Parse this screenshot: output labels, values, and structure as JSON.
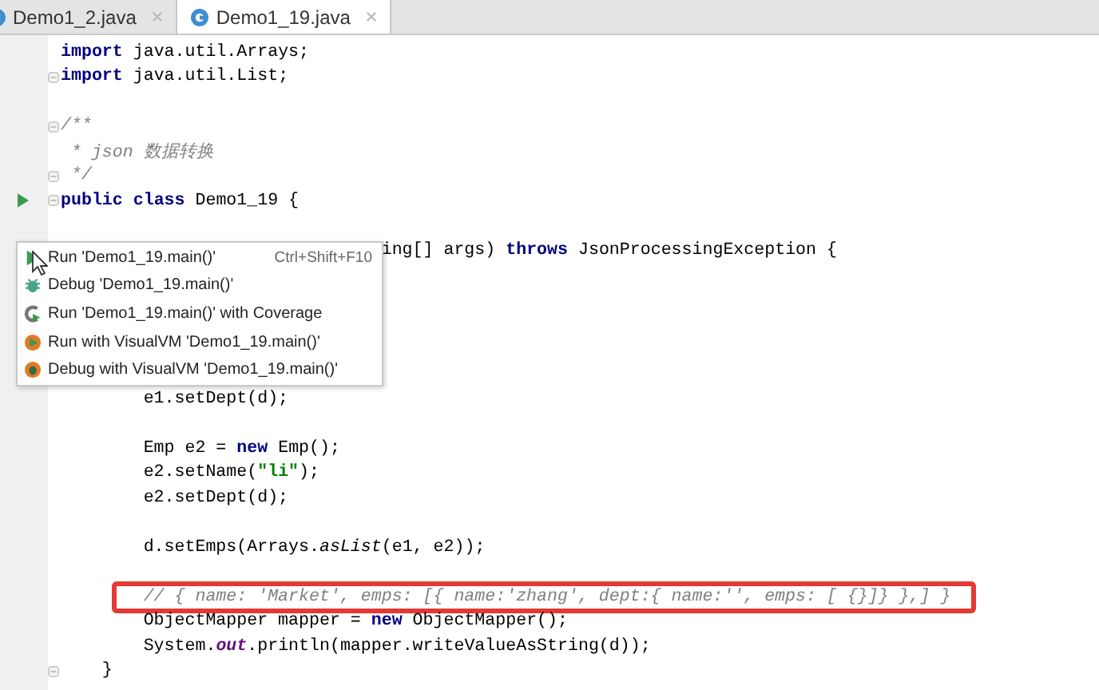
{
  "tabs": [
    {
      "label": "Demo1_2.java",
      "selected": false
    },
    {
      "label": "Demo1_19.java",
      "selected": true
    }
  ],
  "code_blocks": [
    {
      "menu_after": false,
      "lines": [
        {
          "fold": false,
          "run": false,
          "tokens": [
            {
              "kind": "keyword",
              "text": "import"
            },
            {
              "kind": "plain",
              "text": " java.util.Arrays;"
            }
          ]
        },
        {
          "fold": true,
          "run": false,
          "tokens": [
            {
              "kind": "keyword",
              "text": "import"
            },
            {
              "kind": "plain",
              "text": " java.util.List;"
            }
          ]
        }
      ]
    },
    {
      "menu_after": false,
      "lines": [
        {
          "fold": true,
          "run": false,
          "tokens": [
            {
              "kind": "comment",
              "text": "/**"
            }
          ]
        },
        {
          "fold": false,
          "run": false,
          "tokens": [
            {
              "kind": "comment",
              "text": " * json 数据转换"
            }
          ]
        },
        {
          "fold": true,
          "run": false,
          "tokens": [
            {
              "kind": "comment",
              "text": " */"
            }
          ]
        },
        {
          "fold": true,
          "run": true,
          "tokens": [
            {
              "kind": "keyword",
              "text": "public class"
            },
            {
              "kind": "plain",
              "text": " Demo1_19 {"
            }
          ]
        }
      ]
    },
    {
      "menu_after": true,
      "lines": [
        {
          "tokens": [
            {
              "kind": "plain",
              "text": "                               ing[] args) "
            },
            {
              "kind": "keyword",
              "text": "throws"
            },
            {
              "kind": "plain",
              "text": " JsonProcessingException {"
            }
          ]
        }
      ]
    },
    {
      "menu_after": false,
      "lines": [
        {
          "tokens": [
            {
              "kind": "plain",
              "text": "        e1.setDept(d);"
            }
          ]
        }
      ]
    },
    {
      "menu_after": false,
      "lines": [
        {
          "fold": false,
          "run": false,
          "tokens": [
            {
              "kind": "plain",
              "text": "        Emp e2 = "
            },
            {
              "kind": "keyword",
              "text": "new"
            },
            {
              "kind": "plain",
              "text": " Emp();"
            }
          ]
        },
        {
          "fold": false,
          "run": false,
          "tokens": [
            {
              "kind": "plain",
              "text": "        e2.setName("
            },
            {
              "kind": "string",
              "text": "\"li\""
            },
            {
              "kind": "plain",
              "text": ");"
            }
          ]
        },
        {
          "fold": false,
          "run": false,
          "tokens": [
            {
              "kind": "plain",
              "text": "        e2.setDept(d);"
            }
          ]
        }
      ]
    },
    {
      "menu_after": false,
      "lines": [
        {
          "fold": false,
          "run": false,
          "tokens": [
            {
              "kind": "plain",
              "text": "        d.setEmps(Arrays."
            },
            {
              "kind": "static_method",
              "text": "asList"
            },
            {
              "kind": "plain",
              "text": "(e1, e2));"
            }
          ]
        }
      ]
    },
    {
      "menu_after": false,
      "lines": [
        {
          "fold": false,
          "run": false,
          "highlighted": true,
          "tokens": [
            {
              "kind": "comment",
              "text": "        // { name: 'Market', emps: [{ name:'zhang', dept:{ name:'', emps: [ {}]} },] }"
            }
          ]
        },
        {
          "fold": false,
          "run": false,
          "tokens": [
            {
              "kind": "plain",
              "text": "        ObjectMapper mapper = "
            },
            {
              "kind": "keyword",
              "text": "new"
            },
            {
              "kind": "plain",
              "text": " ObjectMapper();"
            }
          ]
        },
        {
          "fold": false,
          "run": false,
          "tokens": [
            {
              "kind": "plain",
              "text": "        System."
            },
            {
              "kind": "static_field",
              "text": "out"
            },
            {
              "kind": "plain",
              "text": ".println(mapper.writeValueAsString(d));"
            }
          ]
        },
        {
          "fold": true,
          "run": false,
          "tokens": [
            {
              "kind": "plain",
              "text": "    }"
            }
          ]
        }
      ]
    }
  ],
  "popup_menu": {
    "items": [
      {
        "kind": "run",
        "label": "Run 'Demo1_19.main()'",
        "shortcut": "Ctrl+Shift+F10"
      },
      {
        "kind": "debug",
        "label": "Debug 'Demo1_19.main()'"
      },
      {
        "kind": "coverage",
        "label": "Run 'Demo1_19.main()' with Coverage"
      },
      {
        "kind": "visualvm_run",
        "label": "Run with VisualVM 'Demo1_19.main()'"
      },
      {
        "kind": "visualvm_debug",
        "label": "Debug with VisualVM 'Demo1_19.main()'"
      }
    ]
  }
}
